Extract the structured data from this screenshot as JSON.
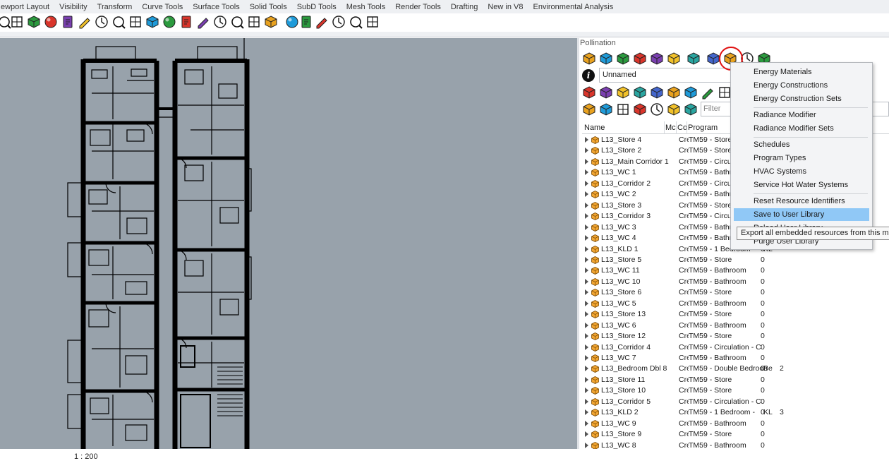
{
  "tabs": [
    "ewport Layout",
    "Visibility",
    "Transform",
    "Curve Tools",
    "Surface Tools",
    "Solid Tools",
    "SubD Tools",
    "Mesh Tools",
    "Render Tools",
    "Drafting",
    "New in V8",
    "Environmental Analysis"
  ],
  "toolbar_icons": [
    "zoom-icon",
    "zoom-extents-icon",
    "zoom-window-icon",
    "zoom-selected-icon",
    "rotate-view-icon",
    "four-viewports-icon",
    "car-icon",
    "grid-icon",
    "circle-icon",
    "points-icon",
    "light-bulb-icon",
    "lock-icon",
    "material-icon",
    "color-wheel-icon",
    "sphere-icon",
    "mesh-sphere-icon",
    "render-sphere-icon",
    "pencil-icon",
    "gears-icon",
    "dimension-icon",
    "globe-icon",
    "help-icon",
    "exit-icon"
  ],
  "viewport": {
    "scale": "1 : 200"
  },
  "panel": {
    "title": "Pollination",
    "model_name": "Unnamed",
    "filter_placeholder": "Filter",
    "columns": {
      "name": "Name",
      "c1": "Mc",
      "c2": "Co",
      "program": "Program"
    }
  },
  "rows": [
    {
      "name": "L13_Store 4",
      "c1": "Cre",
      "program": "TM59 - Store",
      "c3": "",
      "c4": ""
    },
    {
      "name": "L13_Store 2",
      "c1": "Cre",
      "program": "TM59 - Store",
      "c3": "",
      "c4": ""
    },
    {
      "name": "L13_Main Corridor 1",
      "c1": "Cre",
      "program": "TM59 - Circulation",
      "c3": "",
      "c4": ""
    },
    {
      "name": "L13_WC 1",
      "c1": "Cre",
      "program": "TM59 - Bathroom",
      "c3": "",
      "c4": ""
    },
    {
      "name": "L13_Corridor 2",
      "c1": "Cre",
      "program": "TM59 - Circulation",
      "c3": "",
      "c4": ""
    },
    {
      "name": "L13_WC 2",
      "c1": "Cre",
      "program": "TM59 - Bathroom",
      "c3": "",
      "c4": ""
    },
    {
      "name": "L13_Store 3",
      "c1": "Cre",
      "program": "TM59 - Store",
      "c3": "",
      "c4": ""
    },
    {
      "name": "L13_Corridor 3",
      "c1": "Cre",
      "program": "TM59 - Circulation",
      "c3": "",
      "c4": ""
    },
    {
      "name": "L13_WC 3",
      "c1": "Cre",
      "program": "TM59 - Bathroom",
      "c3": "",
      "c4": ""
    },
    {
      "name": "L13_WC 4",
      "c1": "Cre",
      "program": "TM59 - Bathroom",
      "c3": "",
      "c4": ""
    },
    {
      "name": "L13_KLD 1",
      "c1": "Cre",
      "program": "TM59 - 1 Bedroom",
      "c3": "KL",
      "c4": "0"
    },
    {
      "name": "L13_Store 5",
      "c1": "Cre",
      "program": "TM59 - Store",
      "c3": "",
      "c4": "0"
    },
    {
      "name": "L13_WC 11",
      "c1": "Cre",
      "program": "TM59 - Bathroom",
      "c3": "",
      "c4": "0"
    },
    {
      "name": "L13_WC 10",
      "c1": "Cre",
      "program": "TM59 - Bathroom",
      "c3": "",
      "c4": "0"
    },
    {
      "name": "L13_Store 6",
      "c1": "Cre",
      "program": "TM59 - Store",
      "c3": "",
      "c4": "0"
    },
    {
      "name": "L13_WC 5",
      "c1": "Cre",
      "program": "TM59 - Bathroom",
      "c3": "",
      "c4": "0"
    },
    {
      "name": "L13_Store 13",
      "c1": "Cre",
      "program": "TM59 - Store",
      "c3": "",
      "c4": "0"
    },
    {
      "name": "L13_WC 6",
      "c1": "Cre",
      "program": "TM59 - Bathroom",
      "c3": "",
      "c4": "0"
    },
    {
      "name": "L13_Store 12",
      "c1": "Cre",
      "program": "TM59 - Store",
      "c3": "",
      "c4": "0"
    },
    {
      "name": "L13_Corridor 4",
      "c1": "Cre",
      "program": "TM59 - Circulation - C",
      "c3": "",
      "c4": "0"
    },
    {
      "name": "L13_WC 7",
      "c1": "Cre",
      "program": "TM59 - Bathroom",
      "c3": "",
      "c4": "0"
    },
    {
      "name": "L13_Bedroom Dbl 8",
      "c1": "Cre",
      "program": "TM59 - Double Bedroom",
      "c3": "Be",
      "c4": "0",
      "c5": "2"
    },
    {
      "name": "L13_Store 11",
      "c1": "Cre",
      "program": "TM59 - Store",
      "c3": "",
      "c4": "0"
    },
    {
      "name": "L13_Store 10",
      "c1": "Cre",
      "program": "TM59 - Store",
      "c3": "",
      "c4": "0"
    },
    {
      "name": "L13_Corridor 5",
      "c1": "Cre",
      "program": "TM59 - Circulation - C",
      "c3": "",
      "c4": "0"
    },
    {
      "name": "L13_KLD 2",
      "c1": "Cre",
      "program": "TM59 - 1 Bedroom -",
      "c3": "KL",
      "c4": "0",
      "c5": "3"
    },
    {
      "name": "L13_WC 9",
      "c1": "Cre",
      "program": "TM59 - Bathroom",
      "c3": "",
      "c4": "0"
    },
    {
      "name": "L13_Store 9",
      "c1": "Cre",
      "program": "TM59 - Store",
      "c3": "",
      "c4": "0"
    },
    {
      "name": "L13_WC 8",
      "c1": "Cre",
      "program": "TM59 - Bathroom",
      "c3": "",
      "c4": "0"
    }
  ],
  "menu": {
    "items": [
      {
        "label": "Energy Materials",
        "group": 1
      },
      {
        "label": "Energy Constructions",
        "group": 1
      },
      {
        "label": "Energy Construction Sets",
        "group": 1
      },
      {
        "label": "Radiance Modifier",
        "group": 2
      },
      {
        "label": "Radiance Modifier Sets",
        "group": 2
      },
      {
        "label": "Schedules",
        "group": 3
      },
      {
        "label": "Program Types",
        "group": 3
      },
      {
        "label": "HVAC Systems",
        "group": 3
      },
      {
        "label": "Service Hot Water Systems",
        "group": 3
      },
      {
        "label": "Reset Resource Identifiers",
        "group": 4
      },
      {
        "label": "Save to User Library",
        "group": 4,
        "selected": true
      },
      {
        "label": "Reload User Library",
        "group": 4
      },
      {
        "label": "Purge User Library",
        "group": 4
      }
    ],
    "tooltip": "Export all embedded resources from this model"
  },
  "colors": {
    "viewport": "#98a2ab",
    "selection": "#90c8f6",
    "highlight_ring": "#e01010",
    "room_cube": "#f2a531"
  }
}
